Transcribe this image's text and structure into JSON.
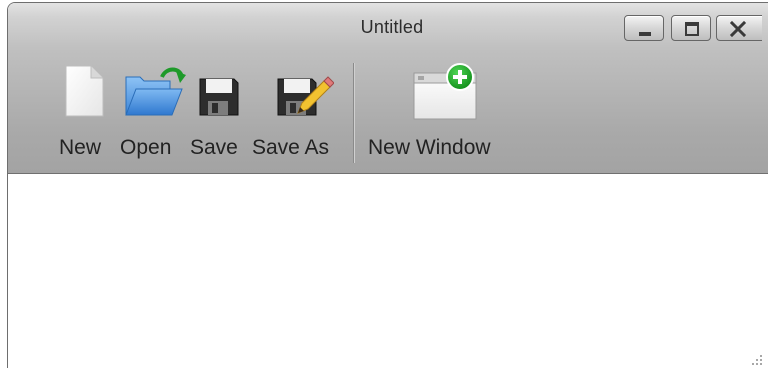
{
  "window": {
    "title": "Untitled",
    "controls": [
      "minimize",
      "maximize",
      "close"
    ]
  },
  "toolbar": {
    "items": [
      {
        "label": "New",
        "icon": "new-document-icon"
      },
      {
        "label": "Open",
        "icon": "open-folder-icon"
      },
      {
        "label": "Save",
        "icon": "floppy-disk-icon"
      },
      {
        "label": "Save As",
        "icon": "save-as-icon"
      },
      {
        "label": "New Window",
        "icon": "new-window-icon"
      }
    ]
  },
  "colors": {
    "toolbar_top": "#e3e3e3",
    "toolbar_bottom": "#a3a3a3",
    "folder_blue": "#3f8fe0",
    "refresh_green": "#1e9a2a",
    "add_green": "#17a521",
    "pencil_yellow": "#f2c230"
  }
}
